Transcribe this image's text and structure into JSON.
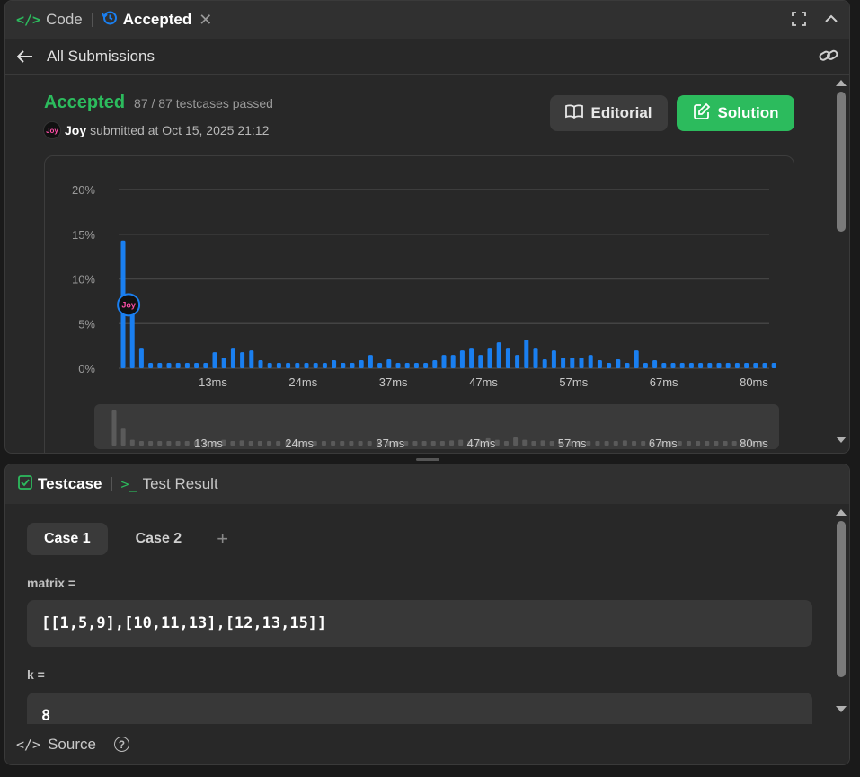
{
  "tabs": {
    "code_label": "Code",
    "accepted_label": "Accepted"
  },
  "subbar": {
    "back_label": "All Submissions"
  },
  "submission": {
    "status": "Accepted",
    "testcases": "87 / 87 testcases passed",
    "user": "Joy",
    "submitted_text": "submitted at Oct 15, 2025 21:12",
    "avatar_text": "Joy"
  },
  "buttons": {
    "editorial": "Editorial",
    "solution": "Solution"
  },
  "colors": {
    "accent_green": "#2cbb5d",
    "bar_blue": "#1a7ff0",
    "bar_gray": "#5a5a5a"
  },
  "chart_data": {
    "type": "bar",
    "yticks": [
      "0%",
      "5%",
      "10%",
      "15%",
      "20%"
    ],
    "ylim": [
      0,
      20
    ],
    "xticks": [
      "13ms",
      "24ms",
      "37ms",
      "47ms",
      "57ms",
      "67ms",
      "80ms"
    ],
    "values": [
      14.3,
      6.7,
      2.3,
      0.6,
      0.6,
      0.6,
      0.6,
      0.6,
      0.6,
      0.6,
      1.8,
      1.2,
      2.3,
      1.8,
      2.0,
      0.9,
      0.6,
      0.6,
      0.6,
      0.6,
      0.6,
      0.6,
      0.6,
      0.9,
      0.6,
      0.6,
      0.9,
      1.5,
      0.6,
      1.0,
      0.6,
      0.6,
      0.6,
      0.6,
      0.9,
      1.5,
      1.5,
      2.0,
      2.3,
      1.5,
      2.3,
      2.9,
      2.3,
      1.5,
      3.2,
      2.3,
      1.0,
      2.0,
      1.2,
      1.2,
      1.2,
      1.5,
      0.9,
      0.6,
      1.0,
      0.6,
      2.0,
      0.6,
      0.9,
      0.6,
      0.6,
      0.6,
      0.6,
      0.6,
      0.6,
      0.6,
      0.6,
      0.6,
      0.6,
      0.6,
      0.6,
      0.6
    ],
    "highlight_index": 1,
    "marker_label": "Joy"
  },
  "testcase": {
    "tab_testcase": "Testcase",
    "tab_result": "Test Result",
    "case1": "Case 1",
    "case2": "Case 2",
    "add": "+",
    "matrix_label": "matrix =",
    "matrix_value": "[[1,5,9],[10,11,13],[12,13,15]]",
    "k_label": "k =",
    "k_value": "8"
  },
  "footer": {
    "source_label": "Source",
    "help_label": "?"
  }
}
